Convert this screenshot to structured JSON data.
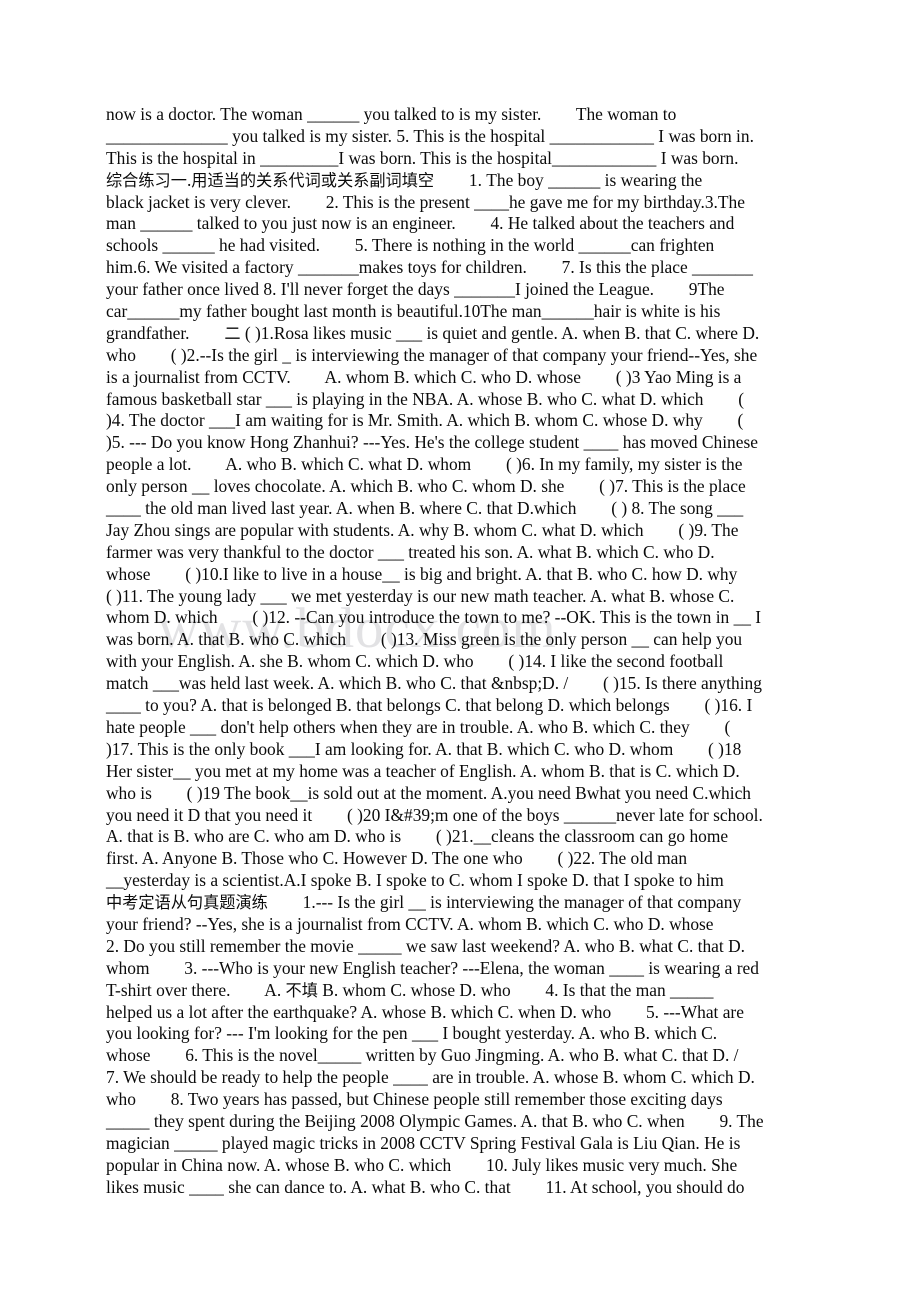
{
  "document": {
    "type": "scanned-worksheet-page",
    "subject_language": "English grammar exercises (Chinese worksheet)",
    "background_color": "#ffffff",
    "text_color": "#0b0b0b",
    "watermark": {
      "text": "www.bdocx.com",
      "color": "#e2e2e4"
    },
    "lines": [
      "now is a doctor. The woman ______ you talked to is my sister.        The woman to",
      "______________ you talked is my sister. 5. This is the hospital ____________ I was born in.",
      "This is the hospital in _________I was born. This is the hospital____________ I was born.",
      "综合练习一.用适当的关系代词或关系副词填空        1. The boy ______ is wearing the",
      "black jacket is very clever.        2. This is the present ____he gave me for my birthday.3.The",
      "man ______ talked to you just now is an engineer.        4. He talked about the teachers and",
      "schools ______ he had visited.        5. There is nothing in the world ______can frighten",
      "him.6. We visited a factory _______makes toys for children.        7. Is this the place _______",
      "your father once lived 8. I'll never forget the days _______I joined the League.        9The",
      "car______my father bought last month is beautiful.10The man______hair is white is his",
      "grandfather.        二 ( )1.Rosa likes music ___ is quiet and gentle. A. when B. that C. where D.",
      "who        ( )2.--Is the girl _ is interviewing the manager of that company your friend--Yes, she",
      "is a journalist from CCTV.        A. whom B. which C. who D. whose        ( )3 Yao Ming is a",
      "famous basketball star ___ is playing in the NBA. A. whose B. who C. what D. which        (",
      ")4. The doctor ___I am waiting for is Mr. Smith. A. which B. whom C. whose D. why        (",
      ")5. --- Do you know Hong Zhanhui? ---Yes. He's the college student ____ has moved Chinese",
      "people a lot.        A. who B. which C. what D. whom        ( )6. In my family, my sister is the",
      "only person __ loves chocolate. A. which B. who C. whom D. she        ( )7. This is the place",
      "____ the old man lived last year. A. when B. where C. that D.which        ( ) 8. The song ___",
      "Jay Zhou sings are popular with students. A. why B. whom C. what D. which        ( )9. The",
      "farmer was very thankful to the doctor ___ treated his son. A. what B. which C. who D.",
      "whose        ( )10.I like to live in a house__ is big and bright. A. that B. who C. how D. why",
      "( )11. The young lady ___ we met yesterday is our new math teacher. A. what B. whose C.",
      "whom D. which        ( )12. --Can you introduce the town to me? --OK. This is the town in __ I",
      "was born. A. that B. who C. which        ( )13. Miss green is the only person __ can help you",
      "with your English. A. she B. whom C. which D. who        ( )14. I like the second football",
      "match ___was held last week. A. which B. who C. that &nbsp;D. /        ( )15. Is there anything",
      "____ to you? A. that is belonged B. that belongs C. that belong D. which belongs        ( )16. I",
      "hate people ___ don't help others when they are in trouble. A. who B. which C. they        (",
      ")17. This is the only book ___I am looking for. A. that B. which C. who D. whom        ( )18",
      "Her sister__ you met at my home was a teacher of English. A. whom B. that is C. which D.",
      "who is        ( )19 The book__is sold out at the moment. A.you need Bwhat you need C.which",
      "you need it D that you need it        ( )20 I&#39;m one of the boys ______never late for school.",
      "A. that is B. who are C. who am D. who is        ( )21.__cleans the classroom can go home",
      "first. A. Anyone B. Those who C. However D. The one who        ( )22. The old man",
      "__yesterday is a scientist.A.I spoke B. I spoke to C. whom I spoke D. that I spoke to him",
      "中考定语从句真题演练        1.--- Is the girl __ is interviewing the manager of that company",
      "your friend? --Yes, she is a journalist from CCTV. A. whom B. which C. who D. whose",
      "2. Do you still remember the movie _____ we saw last weekend? A. who B. what C. that D.",
      "whom        3. ---Who is your new English teacher? ---Elena, the woman ____ is wearing a red",
      "T-shirt over there.        A. 不填 B. whom C. whose D. who        4. Is that the man _____",
      "helped us a lot after the earthquake? A. whose B. which C. when D. who        5. ---What are",
      "you looking for? --- I'm looking for the pen ___ I bought yesterday. A. who B. which C.",
      "whose        6. This is the novel_____ written by Guo Jingming. A. who B. what C. that D. /",
      "7. We should be ready to help the people ____ are in trouble. A. whose B. whom C. which D.",
      "who        8. Two years has passed, but Chinese people still remember those exciting days",
      "_____ they spent during the Beijing 2008 Olympic Games. A. that B. who C. when        9. The",
      "magician _____ played magic tricks in 2008 CCTV Spring Festival Gala is Liu Qian. He is",
      "popular in China now. A. whose B. who C. which        10. July likes music very much. She",
      "likes music ____ she can dance to. A. what B. who C. that        11. At school, you should do"
    ]
  }
}
